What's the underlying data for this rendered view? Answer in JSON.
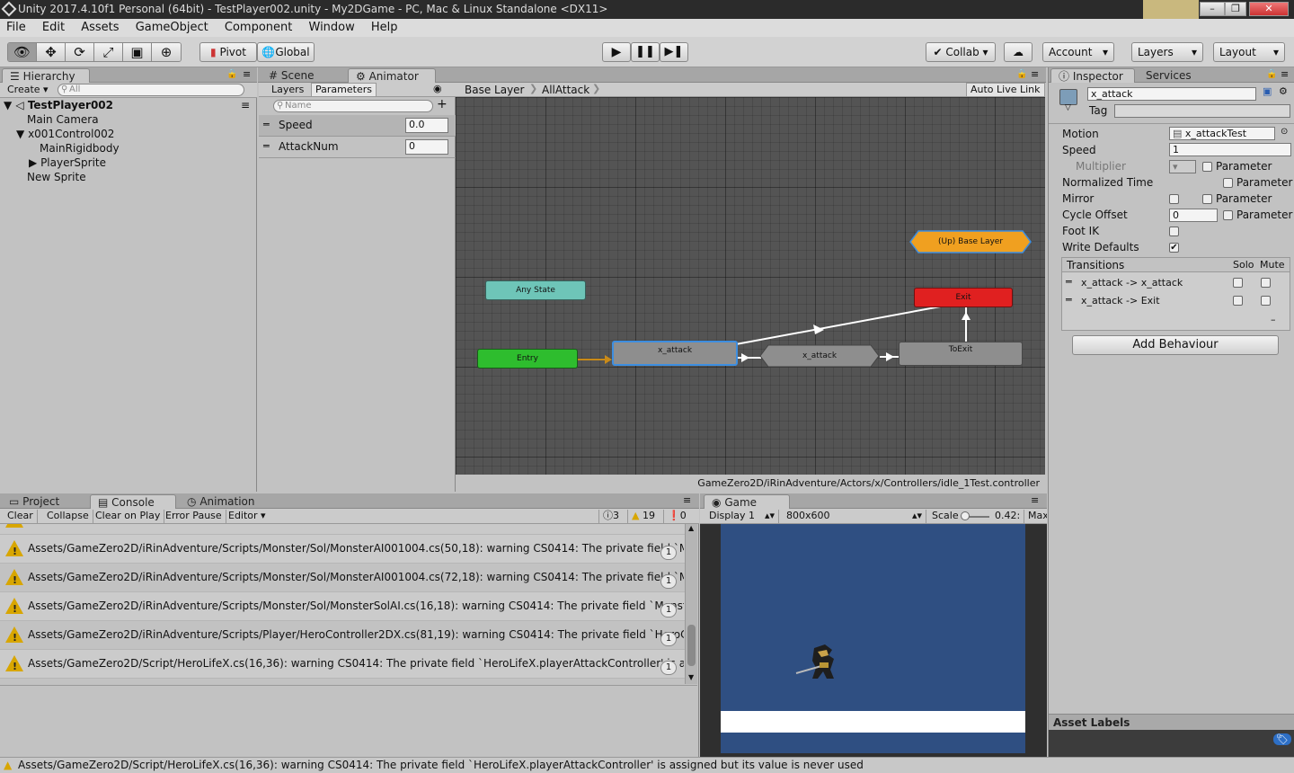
{
  "window": {
    "title": "Unity 2017.4.10f1 Personal (64bit) - TestPlayer002.unity - My2DGame - PC, Mac & Linux Standalone <DX11>"
  },
  "menu": [
    "File",
    "Edit",
    "Assets",
    "GameObject",
    "Component",
    "Window",
    "Help"
  ],
  "toolbar": {
    "pivot": "Pivot",
    "global": "Global",
    "collab": "Collab",
    "account": "Account",
    "layers": "Layers",
    "layout": "Layout"
  },
  "hierarchy": {
    "tab": "Hierarchy",
    "create": "Create",
    "search_placeholder": "All",
    "scene": "TestPlayer002",
    "items": [
      "Main Camera",
      "x001Control002",
      "MainRigidbody",
      "PlayerSprite",
      "New Sprite"
    ]
  },
  "tabs": {
    "scene": "Scene",
    "animator": "Animator",
    "inspector": "Inspector",
    "services": "Services",
    "project": "Project",
    "console": "Console",
    "animation": "Animation",
    "game": "Game"
  },
  "animator": {
    "layers_tab": "Layers",
    "parameters_tab": "Parameters",
    "name_placeholder": "Name",
    "params": [
      {
        "name": "Speed",
        "value": "0.0"
      },
      {
        "name": "AttackNum",
        "value": "0"
      }
    ],
    "breadcrumb": [
      "Base Layer",
      "AllAttack"
    ],
    "auto_live_link": "Auto Live Link",
    "nodes": {
      "any_state": "Any State",
      "entry": "Entry",
      "x_attack_1": "x_attack",
      "x_attack_2": "x_attack",
      "to_exit": "ToExit",
      "exit": "Exit",
      "up_base": "(Up) Base Layer"
    },
    "colors": {
      "entry": "#2ebd2e",
      "any_state": "#6ec5b8",
      "exit": "#e02020",
      "up": "#f0a020",
      "state": "#8e8e8e",
      "selected_outline": "#3d8ee0"
    },
    "path": "GameZero2D/iRinAdventure/Actors/x/Controllers/idle_1Test.controller"
  },
  "inspector": {
    "name": "x_attack",
    "tag_label": "Tag",
    "motion_label": "Motion",
    "motion_value": "x_attackTest",
    "speed_label": "Speed",
    "speed_value": "1",
    "multiplier_label": "Multiplier",
    "parameter_label": "Parameter",
    "normalized_time_label": "Normalized Time",
    "mirror_label": "Mirror",
    "cycle_offset_label": "Cycle Offset",
    "cycle_offset_value": "0",
    "foot_ik_label": "Foot IK",
    "write_defaults_label": "Write Defaults",
    "transitions_label": "Transitions",
    "solo_label": "Solo",
    "mute_label": "Mute",
    "transitions": [
      "x_attack -> x_attack",
      "x_attack -> Exit"
    ],
    "add_behaviour": "Add Behaviour",
    "asset_labels": "Asset Labels"
  },
  "console": {
    "clear": "Clear",
    "collapse": "Collapse",
    "clear_on_play": "Clear on Play",
    "error_pause": "Error Pause",
    "editor": "Editor",
    "info_count": "3",
    "warn_count": "19",
    "error_count": "0",
    "rows": [
      {
        "text": "Assets/GameZero2D/iRinAdventure/Scripts/Monster/Sol/MonsterAI001004.cs(50,18): warning CS0414: The private field `Monster",
        "count": "1"
      },
      {
        "text": "Assets/GameZero2D/iRinAdventure/Scripts/Monster/Sol/MonsterAI001004.cs(72,18): warning CS0414: The private field `Monster",
        "count": "1"
      },
      {
        "text": "Assets/GameZero2D/iRinAdventure/Scripts/Monster/Sol/MonsterSolAI.cs(16,18): warning CS0414: The private field `MonsterS",
        "count": "1"
      },
      {
        "text": "Assets/GameZero2D/iRinAdventure/Scripts/Player/HeroController2DX.cs(81,19): warning CS0414: The private field `HeroCont",
        "count": "1"
      },
      {
        "text": "Assets/GameZero2D/Script/HeroLifeX.cs(16,36): warning CS0414: The private field `HeroLifeX.playerAttackController' is assig",
        "count": "1"
      }
    ]
  },
  "game": {
    "display": "Display 1",
    "resolution": "800x600",
    "scale_label": "Scale",
    "scale_value": "0.42:",
    "maximize": "Max"
  },
  "status": "Assets/GameZero2D/Script/HeroLifeX.cs(16,36): warning CS0414: The private field `HeroLifeX.playerAttackController' is assigned but its value is never used"
}
